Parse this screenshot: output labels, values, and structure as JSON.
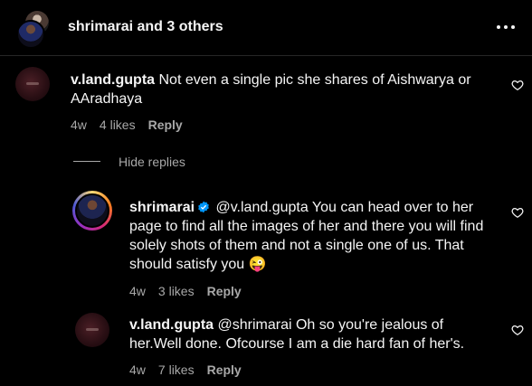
{
  "header": {
    "title": "shrimarai and 3 others"
  },
  "comments": [
    {
      "username": "v.land.gupta",
      "text": "Not even a single pic she shares of Aishwarya or AAradhaya",
      "time": "4w",
      "likes": "4 likes",
      "reply": "Reply"
    },
    {
      "username": "shrimarai",
      "text": "@v.land.gupta You can head over to her page to find all the images of her and there you will find solely shots of them and not a single one of us. That should satisfy you",
      "emoji": "😜",
      "time": "4w",
      "likes": "3 likes",
      "reply": "Reply"
    },
    {
      "username": "v.land.gupta",
      "text": "@shrimarai Oh so you're jealous of her.Well done. Ofcourse I am a die hard fan of her's.",
      "time": "4w",
      "likes": "7 likes",
      "reply": "Reply"
    }
  ],
  "hide_replies": "Hide replies",
  "colors": {
    "background": "#000000",
    "text": "#f5f5f5",
    "muted": "#a8a8a8",
    "verified": "#0095f6"
  }
}
